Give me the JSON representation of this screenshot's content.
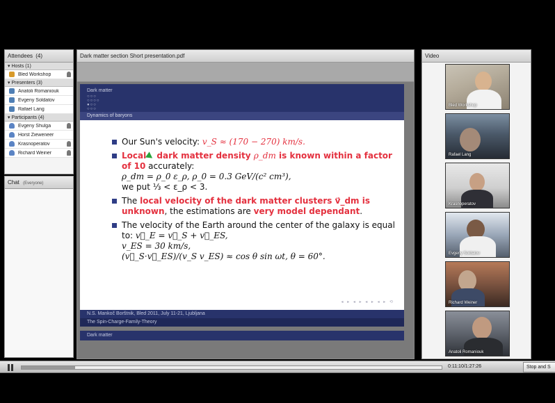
{
  "attendees": {
    "title": "Attendees",
    "title_suffix": "(4)",
    "hosts_label": "Hosts (1)",
    "hosts": [
      "Bled Workshop"
    ],
    "presenters_label": "Presenters (3)",
    "presenters": [
      "Anatoli Romaniouk",
      "Evgeny Soldatov",
      "Rafael Lang"
    ],
    "participants_label": "Participants (4)",
    "participants": [
      "Evgeny Shulga",
      "Horst Zieweneer",
      "Krasnoperatov",
      "Richard Weiner"
    ]
  },
  "chat": {
    "title": "Chat",
    "scope": "(Everyone)"
  },
  "document": {
    "title": "Dark matter section Short presentation.pdf"
  },
  "slide": {
    "section": "Dark matter",
    "subtitle": "Dynamics of baryons",
    "b1_text": "Our Sun's velocity: ",
    "b1_math": "v_S ≈ (170 − 270) km/s.",
    "b2_red_a": "Local",
    "b2_red_b": " dark matter density ",
    "b2_math": "ρ_dm",
    "b2_red_c": " is known within a factor of 10",
    "b2_rest": " accurately:",
    "b2_line2": "ρ_dm = ρ_0 ε_ρ, ρ_0 = 0.3 GeV/(c² cm³),",
    "b2_line3": "we put ⅓ < ε_ρ < 3.",
    "b3_a": "The ",
    "b3_red_a": "local velocity of the dark matter clusters v⃗_dm",
    "b3_red_b": " is unknown",
    "b3_rest": ", the estimations are ",
    "b3_red_c": "very model dependant",
    "b3_end": ".",
    "b4_text": "The velocity of the Earth around the center of the galaxy is equal to: ",
    "b4_math": "v⃗_E = v⃗_S + v⃗_ES,",
    "b4_line2": "v_ES = 30 km/s,",
    "b4_line3": "(v⃗_S·v⃗_ES)/(v_S v_ES) ≈ cos θ sin ωt, θ = 60°.",
    "footer_authors": "N.S. Mankoč Borštnik, Bled 2011, July 11-21, Ljubljana",
    "footer_theory": "The Spin-Charge-Family-Theory",
    "next_section": "Dark matter"
  },
  "video": {
    "title": "Video",
    "feeds": [
      "Bled Workshop",
      "Rafael Lang",
      "Krasnoperatov",
      "Evgeny Soldatov",
      "Richard Weiner",
      "Anatoli Romaniouk"
    ]
  },
  "player": {
    "timecode": "0:11:10/1:27:26",
    "stop_label": "Stop and S",
    "progress": 0.128
  }
}
